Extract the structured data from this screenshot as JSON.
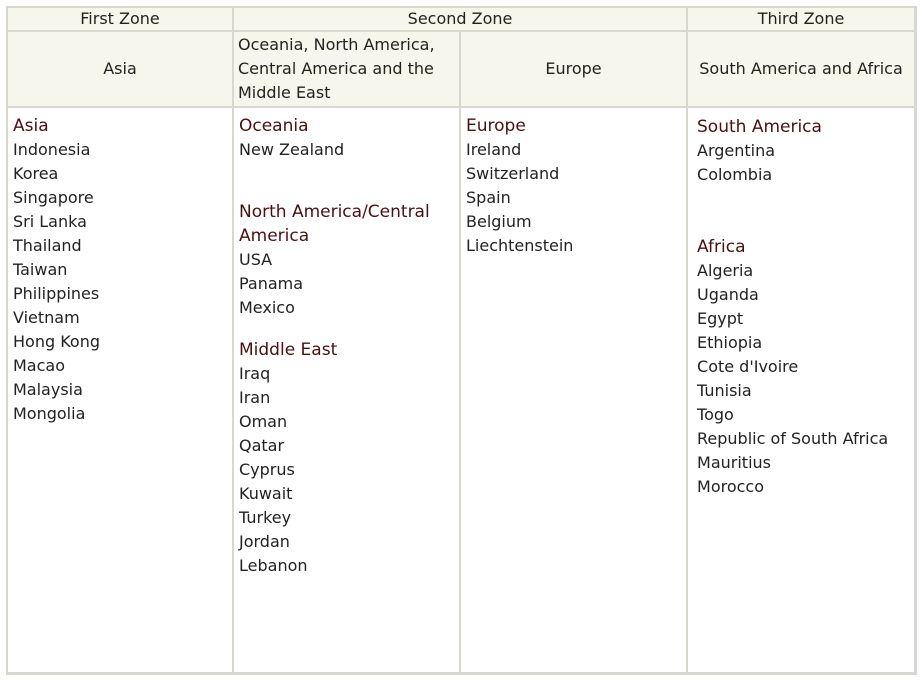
{
  "zones": {
    "first": "First Zone",
    "second": "Second Zone",
    "third": "Third Zone"
  },
  "regions_header": {
    "asia": "Asia",
    "oceania_americas_me": "Oceania, North America, Central America and the Middle East",
    "europe": "Europe",
    "south_america_africa": "South America and Africa"
  },
  "columns": {
    "asia": {
      "groups": [
        {
          "title": "Asia",
          "countries": [
            "Indonesia",
            "Korea",
            "Singapore",
            "Sri Lanka",
            "Thailand",
            "Taiwan",
            "Philippines",
            "Vietnam",
            "Hong Kong",
            "Macao",
            "Malaysia",
            "Mongolia"
          ]
        }
      ]
    },
    "oceania_americas_me": {
      "groups": [
        {
          "title": "Oceania",
          "countries": [
            "New Zealand"
          ]
        },
        {
          "title": "North America/Central America",
          "countries": [
            "USA",
            "Panama",
            "Mexico"
          ]
        },
        {
          "title": "Middle East",
          "countries": [
            "Iraq",
            "Iran",
            "Oman",
            "Qatar",
            "Cyprus",
            "Kuwait",
            "Turkey",
            "Jordan",
            "Lebanon"
          ]
        }
      ]
    },
    "europe": {
      "groups": [
        {
          "title": "Europe",
          "countries": [
            "Ireland",
            "Switzerland",
            "Spain",
            "Belgium",
            "Liechtenstein"
          ]
        }
      ]
    },
    "south_america_africa": {
      "groups": [
        {
          "title": "South America",
          "countries": [
            "Argentina",
            "Colombia"
          ]
        },
        {
          "title": "Africa",
          "countries": [
            "Algeria",
            "Uganda",
            "Egypt",
            "Ethiopia",
            "Cote d'Ivoire",
            "Tunisia",
            "Togo",
            "Republic of South Africa",
            "Mauritius",
            "Morocco"
          ]
        }
      ]
    }
  },
  "colors": {
    "border": "#d8d8cc",
    "header_background": "#f6f6ec",
    "region_title": "#4a1010",
    "text": "#222222"
  }
}
